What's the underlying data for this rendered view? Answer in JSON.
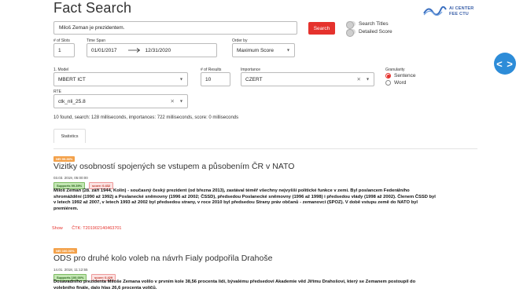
{
  "app": {
    "title": "Fact Search"
  },
  "logo": {
    "line1": "AI CENTER",
    "line2": "FEE CTU"
  },
  "search": {
    "value": "Miloš Zeman je prezidentem.",
    "button_label": "Search"
  },
  "toggles": [
    {
      "label": "Search Titles",
      "on": false
    },
    {
      "label": "Detailed Score",
      "on": false
    }
  ],
  "filters": {
    "slots_label": "# of Slots",
    "slots_value": "1",
    "timespan_label": "Time Span",
    "date_from": "01/01/2017",
    "date_to": "12/31/2020",
    "order_label": "Order by",
    "order_value": "Maximum Score",
    "model_label": "1. Model",
    "model_value": "MBERT ICT",
    "results_label": "# of Results",
    "results_value": "10",
    "importance_label": "Importance",
    "importance_value": "CZERT",
    "granularity_label": "Granularity",
    "granularity_options": [
      {
        "label": "Sentence",
        "selected": true
      },
      {
        "label": "Word",
        "selected": false
      }
    ],
    "rte_label": "RTE",
    "rte_value": "ctk_nli_25.8"
  },
  "summary": "10 found, search: 128 milliseconds, importances: 722 milliseconds, score: 0 milliseconds",
  "tabs": {
    "statistics": "Statistics"
  },
  "results": [
    {
      "nei_badge": "NEI 99.36%",
      "title": "Vizitky osobností spojených se vstupem a působením ČR v NATO",
      "date": "03.03. 2019, 05:00:00",
      "support_badge": "Supports 99.39%",
      "score_badge": "score: 0.432",
      "text_lines": [
        "Miloš Zeman (28. září 1944, Kolín) - současný český prezident (od března 2013), zastával téměř všechny nejvyšší politické funkce v zemi. Byl poslancem Federálního",
        "shromáždění (1990 až 1992) a Poslanecké sněmovny (1996 až 2002; ČSSD), předsedou Poslanecké sněmovny (1996 až 1998) i předsedou vlády (1998 až 2002). Členem ČSSD byl",
        "v letech 1992 až 2007, v letech 1993 až 2002 byl předsedou strany, v roce 2010 byl předsedou Strany práv občanů - zemanovci (SPOZ). V době vstupu země do NATO byl",
        "premiérem."
      ],
      "show_label": "Show",
      "ctk_label": "ČTK: T201902140463701"
    },
    {
      "nei_badge": "NEI 100.00%",
      "title": "ODS pro druhé kolo voleb na návrh Fialy podpořila Drahoše",
      "date": "14.01. 2018, 11:12:55",
      "support_badge": "Supports 100.00%",
      "score_badge": "score: 0.429",
      "text_lines": [
        "Dosavadního prezidenta Miloše Zemana volilo v prvním kole 38,56 procenta lidí, bývalému předsedovi Akademie věd Jiřímu Drahošovi, který se Zemanem postoupil do",
        "volebního finále, dalo hlas 26,6 procenta voličů."
      ]
    }
  ],
  "nav": {
    "label": "< >"
  },
  "colors": {
    "accent": "#e5322d",
    "nav": "#2d8cd8"
  }
}
